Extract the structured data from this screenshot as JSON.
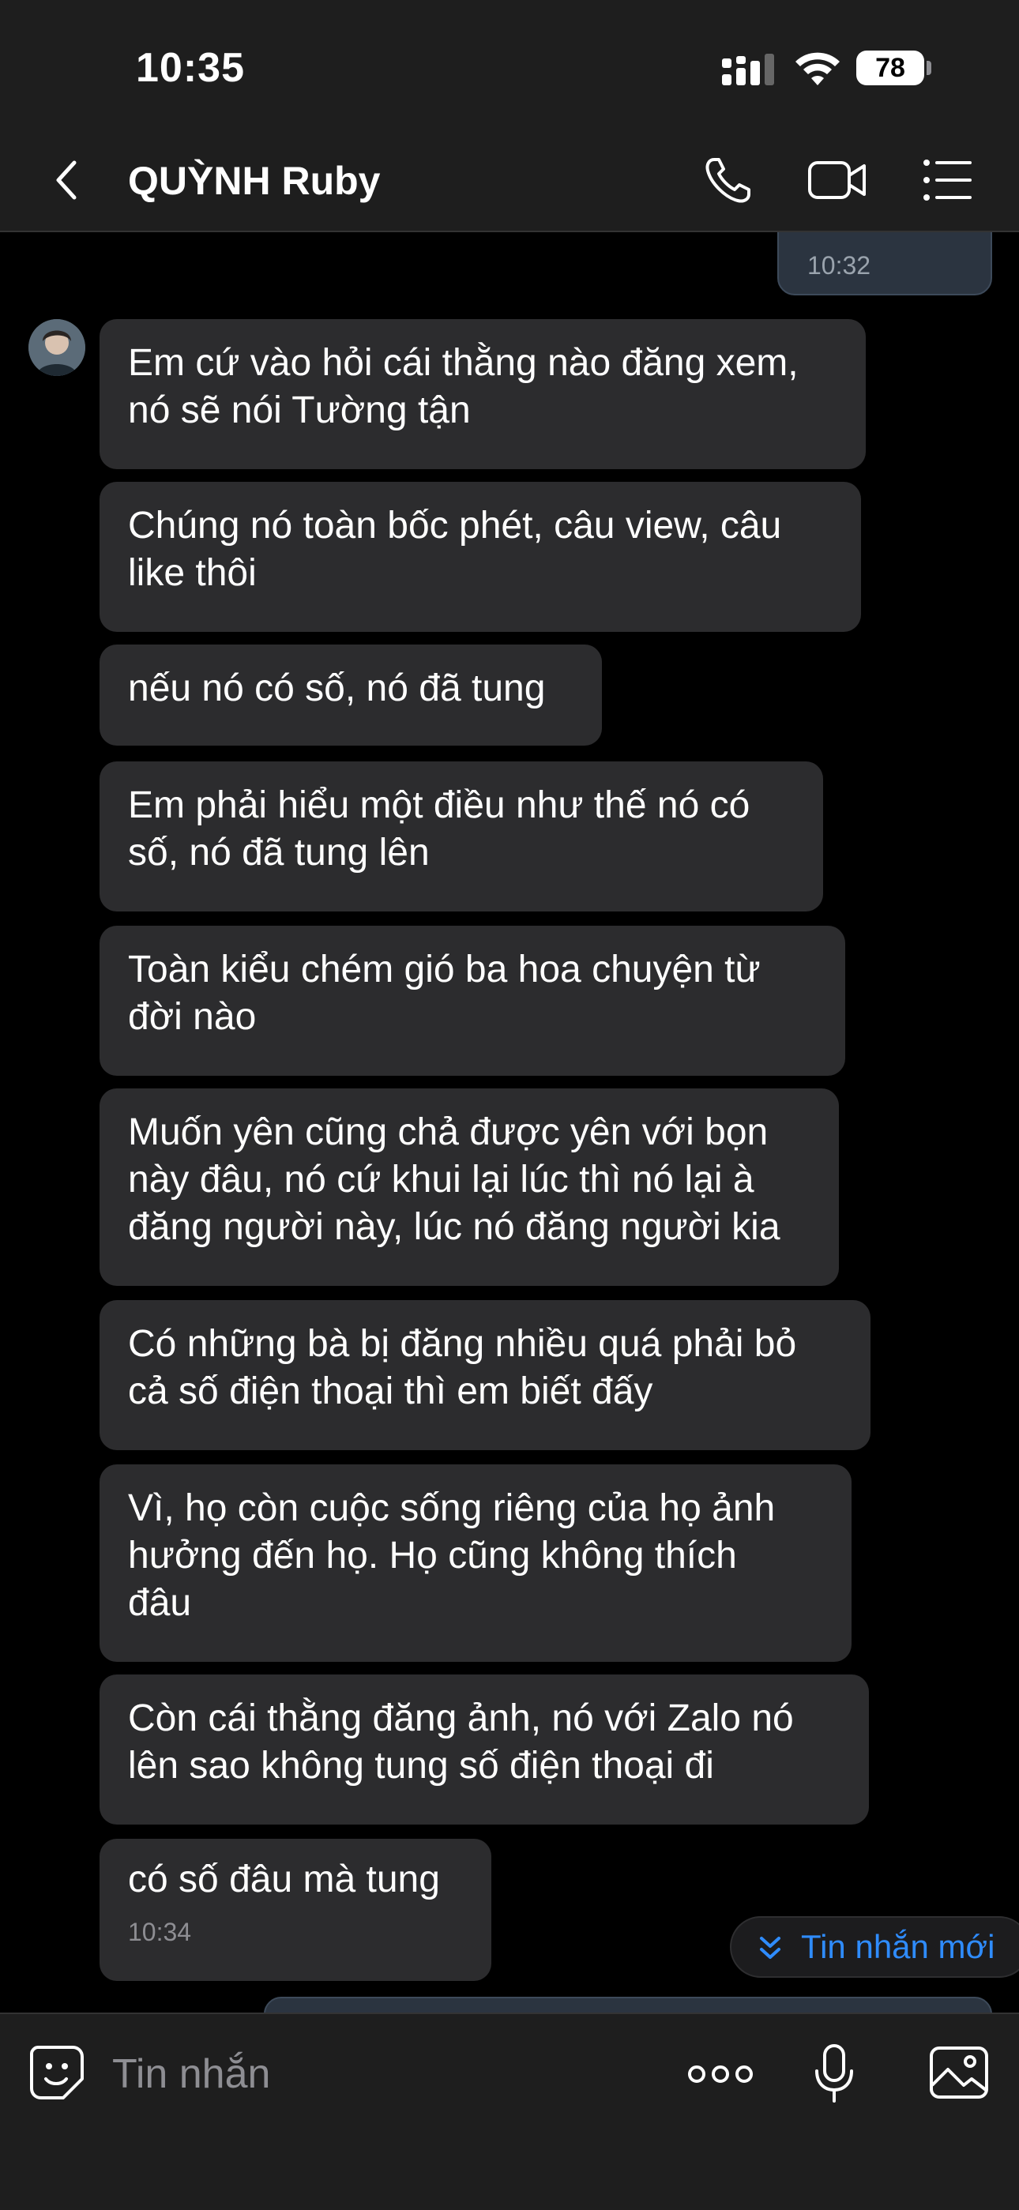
{
  "status_bar": {
    "time": "10:35",
    "battery": "78"
  },
  "header": {
    "contact_name": "QUỲNH Ruby"
  },
  "messages": [
    {
      "text": "",
      "time": "10:32",
      "sender": "me"
    },
    {
      "text": "Em cứ vào hỏi cái thằng nào đăng xem,\nnó sẽ nói Tường tận"
    },
    {
      "text": "Chúng nó toàn bốc phét, câu view, câu\nlike thôi"
    },
    {
      "text": "nếu nó có số, nó đã tung"
    },
    {
      "text": "Em phải hiểu một điều như thế nó có\nsố, nó đã tung lên"
    },
    {
      "text": "Toàn kiểu chém gió ba hoa chuyện từ\nđời nào"
    },
    {
      "text": "Muốn yên cũng chả được yên với bọn\nnày đâu, nó cứ khui lại lúc thì nó lại à\nđăng người này, lúc nó đăng người kia"
    },
    {
      "text": "Có những bà bị đăng nhiều quá phải bỏ\ncả số điện thoại thì em biết đấy"
    },
    {
      "text": "Vì, họ còn cuộc sống riêng của họ ảnh\nhưởng đến họ. Họ cũng không thích\nđâu"
    },
    {
      "text": "Còn cái thằng đăng ảnh, nó với Zalo nó\nlên sao không tung số điện thoại đi"
    },
    {
      "text": "có số đâu mà tung",
      "time": "10:34"
    }
  ],
  "new_messages_button": "Tin nhắn mới",
  "input": {
    "placeholder": "Tin nhắn"
  },
  "icons": [
    "chevron-left-icon",
    "phone-icon",
    "video-camera-icon",
    "list-menu-icon",
    "sticker-icon",
    "more-dots-icon",
    "microphone-icon",
    "image-icon",
    "chevron-down-double-icon"
  ],
  "colors": {
    "background": "#000000",
    "bar": "#1e1e1e",
    "bubble_received": "#2c2c2e",
    "bubble_sent": "#2b3440",
    "accent": "#2f8cff"
  }
}
